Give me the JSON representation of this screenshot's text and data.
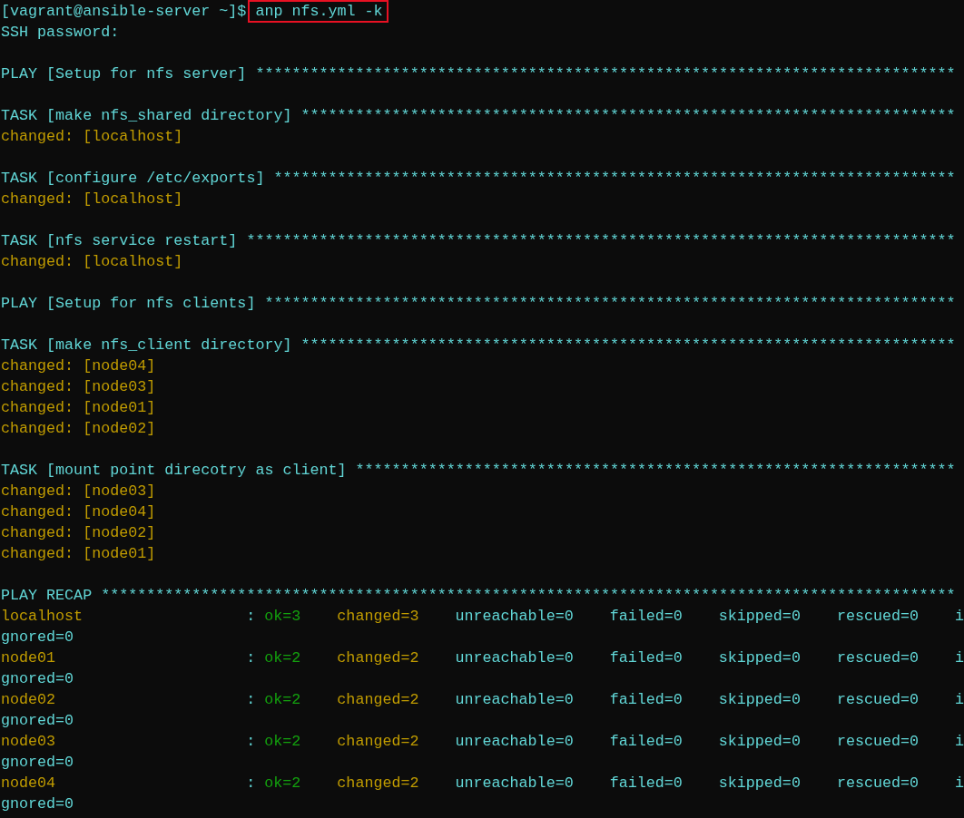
{
  "terminal": {
    "lines": [
      {
        "kind": "prompt",
        "prompt": "[vagrant@ansible-server ~]$",
        "command": "anp nfs.yml -k",
        "highlighted": true
      },
      {
        "kind": "text",
        "text": "SSH password:"
      },
      {
        "kind": "blank"
      },
      {
        "kind": "play",
        "text": "PLAY [Setup for nfs server] *****************************************************************************"
      },
      {
        "kind": "blank"
      },
      {
        "kind": "task",
        "text": "TASK [make nfs_shared directory] ************************************************************************"
      },
      {
        "kind": "changed",
        "text": "changed: [localhost]"
      },
      {
        "kind": "blank"
      },
      {
        "kind": "task",
        "text": "TASK [configure /etc/exports] ***************************************************************************"
      },
      {
        "kind": "changed",
        "text": "changed: [localhost]"
      },
      {
        "kind": "blank"
      },
      {
        "kind": "task",
        "text": "TASK [nfs service restart] ******************************************************************************"
      },
      {
        "kind": "changed",
        "text": "changed: [localhost]"
      },
      {
        "kind": "blank"
      },
      {
        "kind": "play",
        "text": "PLAY [Setup for nfs clients] ****************************************************************************"
      },
      {
        "kind": "blank"
      },
      {
        "kind": "task",
        "text": "TASK [make nfs_client directory] ************************************************************************"
      },
      {
        "kind": "changed",
        "text": "changed: [node04]"
      },
      {
        "kind": "changed",
        "text": "changed: [node03]"
      },
      {
        "kind": "changed",
        "text": "changed: [node01]"
      },
      {
        "kind": "changed",
        "text": "changed: [node02]"
      },
      {
        "kind": "blank"
      },
      {
        "kind": "task",
        "text": "TASK [mount point direcotry as client] ******************************************************************"
      },
      {
        "kind": "changed",
        "text": "changed: [node03]"
      },
      {
        "kind": "changed",
        "text": "changed: [node04]"
      },
      {
        "kind": "changed",
        "text": "changed: [node02]"
      },
      {
        "kind": "changed",
        "text": "changed: [node01]"
      },
      {
        "kind": "blank"
      },
      {
        "kind": "recap_header",
        "text": "PLAY RECAP **********************************************************************************************"
      },
      {
        "kind": "recap",
        "host": "localhost",
        "color": "#c19c00",
        "separator": ":",
        "stats": [
          {
            "text": "ok=3",
            "color": "#13a10e"
          },
          {
            "text": "changed=3",
            "color": "#c19c00"
          },
          {
            "text": "unreachable=0",
            "color": "#61d6d6"
          },
          {
            "text": "failed=0",
            "color": "#61d6d6"
          },
          {
            "text": "skipped=0",
            "color": "#61d6d6"
          },
          {
            "text": "rescued=0",
            "color": "#61d6d6"
          },
          {
            "text": "i",
            "color": "#61d6d6"
          }
        ]
      },
      {
        "kind": "text",
        "text": "gnored=0"
      },
      {
        "kind": "recap",
        "host": "node01",
        "color": "#c19c00",
        "separator": ":",
        "stats": [
          {
            "text": "ok=2",
            "color": "#13a10e"
          },
          {
            "text": "changed=2",
            "color": "#c19c00"
          },
          {
            "text": "unreachable=0",
            "color": "#61d6d6"
          },
          {
            "text": "failed=0",
            "color": "#61d6d6"
          },
          {
            "text": "skipped=0",
            "color": "#61d6d6"
          },
          {
            "text": "rescued=0",
            "color": "#61d6d6"
          },
          {
            "text": "i",
            "color": "#61d6d6"
          }
        ]
      },
      {
        "kind": "text",
        "text": "gnored=0"
      },
      {
        "kind": "recap",
        "host": "node02",
        "color": "#c19c00",
        "separator": ":",
        "stats": [
          {
            "text": "ok=2",
            "color": "#13a10e"
          },
          {
            "text": "changed=2",
            "color": "#c19c00"
          },
          {
            "text": "unreachable=0",
            "color": "#61d6d6"
          },
          {
            "text": "failed=0",
            "color": "#61d6d6"
          },
          {
            "text": "skipped=0",
            "color": "#61d6d6"
          },
          {
            "text": "rescued=0",
            "color": "#61d6d6"
          },
          {
            "text": "i",
            "color": "#61d6d6"
          }
        ]
      },
      {
        "kind": "text",
        "text": "gnored=0"
      },
      {
        "kind": "recap",
        "host": "node03",
        "color": "#c19c00",
        "separator": ":",
        "stats": [
          {
            "text": "ok=2",
            "color": "#13a10e"
          },
          {
            "text": "changed=2",
            "color": "#c19c00"
          },
          {
            "text": "unreachable=0",
            "color": "#61d6d6"
          },
          {
            "text": "failed=0",
            "color": "#61d6d6"
          },
          {
            "text": "skipped=0",
            "color": "#61d6d6"
          },
          {
            "text": "rescued=0",
            "color": "#61d6d6"
          },
          {
            "text": "i",
            "color": "#61d6d6"
          }
        ]
      },
      {
        "kind": "text",
        "text": "gnored=0"
      },
      {
        "kind": "recap",
        "host": "node04",
        "color": "#c19c00",
        "separator": ":",
        "stats": [
          {
            "text": "ok=2",
            "color": "#13a10e"
          },
          {
            "text": "changed=2",
            "color": "#c19c00"
          },
          {
            "text": "unreachable=0",
            "color": "#61d6d6"
          },
          {
            "text": "failed=0",
            "color": "#61d6d6"
          },
          {
            "text": "skipped=0",
            "color": "#61d6d6"
          },
          {
            "text": "rescued=0",
            "color": "#61d6d6"
          },
          {
            "text": "i",
            "color": "#61d6d6"
          }
        ]
      },
      {
        "kind": "text",
        "text": "gnored=0"
      }
    ]
  }
}
